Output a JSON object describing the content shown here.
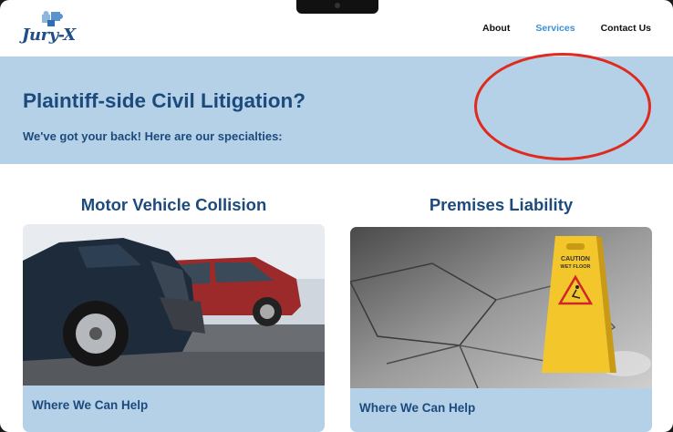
{
  "header": {
    "logo_text": "Jury-X",
    "nav": [
      {
        "label": "About",
        "active": false
      },
      {
        "label": "Services",
        "active": true
      },
      {
        "label": "Contact Us",
        "active": false
      }
    ]
  },
  "hero": {
    "title": "Plaintiff-side Civil Litigation?",
    "subtitle": "We've got your back! Here are our specialties:"
  },
  "services": [
    {
      "title": "Motor Vehicle Collision",
      "image": "car-crash-photo",
      "help_label": "Where We Can Help"
    },
    {
      "title": "Premises Liability",
      "image": "wet-floor-sign-photo",
      "help_label": "Where We Can Help"
    }
  ],
  "sign": {
    "line1": "CAUTION",
    "line2": "WET FLOOR"
  },
  "colors": {
    "brand": "#1d4a7d",
    "nav_active": "#3d8fd6",
    "hero_bg": "#b4d1e8",
    "annotation": "#e02a1f"
  }
}
